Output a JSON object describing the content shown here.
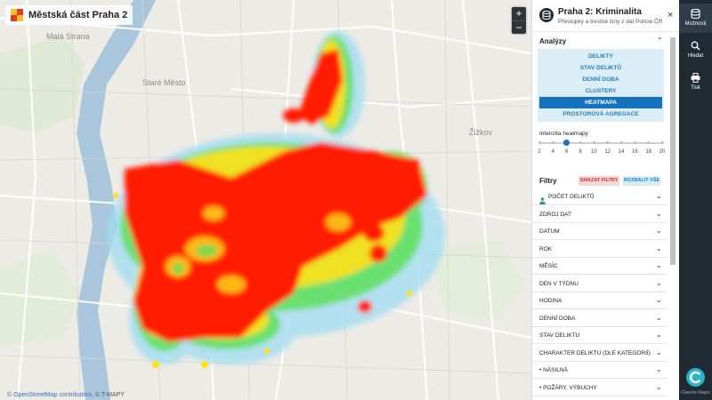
{
  "map": {
    "title": "Městská část Praha 2",
    "labels": {
      "mala_strana": "Malá Strana",
      "stare_mesto": "Staré Město",
      "zizkov": "Žižkov"
    },
    "zoom_in": "+",
    "zoom_out": "−",
    "attribution_osm": "© OpenStreetMap contributors",
    "attribution_tmapy": ", © T-MAPY",
    "heat_colors": {
      "hot": "#ff1a00",
      "warm": "#ffd800",
      "mid": "#46e64b",
      "cool": "#7fd4f0"
    }
  },
  "panel": {
    "title": "Praha 2: Kriminalita",
    "subtitle": "Přestupky a trestné činy z dat Policie ČR",
    "close": "×",
    "analyses": {
      "title": "Analýzy",
      "items": [
        {
          "label": "DELIKTY",
          "active": false
        },
        {
          "label": "STAV DELIKTŮ",
          "active": false
        },
        {
          "label": "DENNÍ DOBA",
          "active": false
        },
        {
          "label": "CLUSTERY",
          "active": false
        },
        {
          "label": "HEATMAPA",
          "active": true
        },
        {
          "label": "PROSTOROVÁ AGREGACE",
          "active": false
        }
      ]
    },
    "heatmap": {
      "label": "Intenzita heatmapy",
      "ticks": [
        "2",
        "4",
        "6",
        "8",
        "10",
        "12",
        "14",
        "16",
        "18",
        "20"
      ],
      "value": 6
    },
    "filters": {
      "title": "Filtry",
      "clear_label": "SMAZAT FILTRY",
      "expand_label": "ROZBALIT VŠE",
      "items": [
        "POČET DELIKTŮ",
        "ZDROJ DAT",
        "DATUM",
        "ROK",
        "MĚSÍC",
        "DEN V TÝDNU",
        "HODINA",
        "DENNÍ DOBA",
        "STAV DELIKTU",
        "CHARAKTER DELIKTU (DLE KATEGORIÍ)",
        "• NÁSILNÁ",
        "• POŽÁRY, VÝBUCHY"
      ]
    }
  },
  "sidebar": {
    "items": [
      {
        "label": "Možnosti",
        "icon": "database-icon"
      },
      {
        "label": "Hledat",
        "icon": "search-icon"
      },
      {
        "label": "Tisk",
        "icon": "print-icon"
      }
    ],
    "logo_label": "Cleerio Maps",
    "bg_color": "#1f2a33"
  }
}
